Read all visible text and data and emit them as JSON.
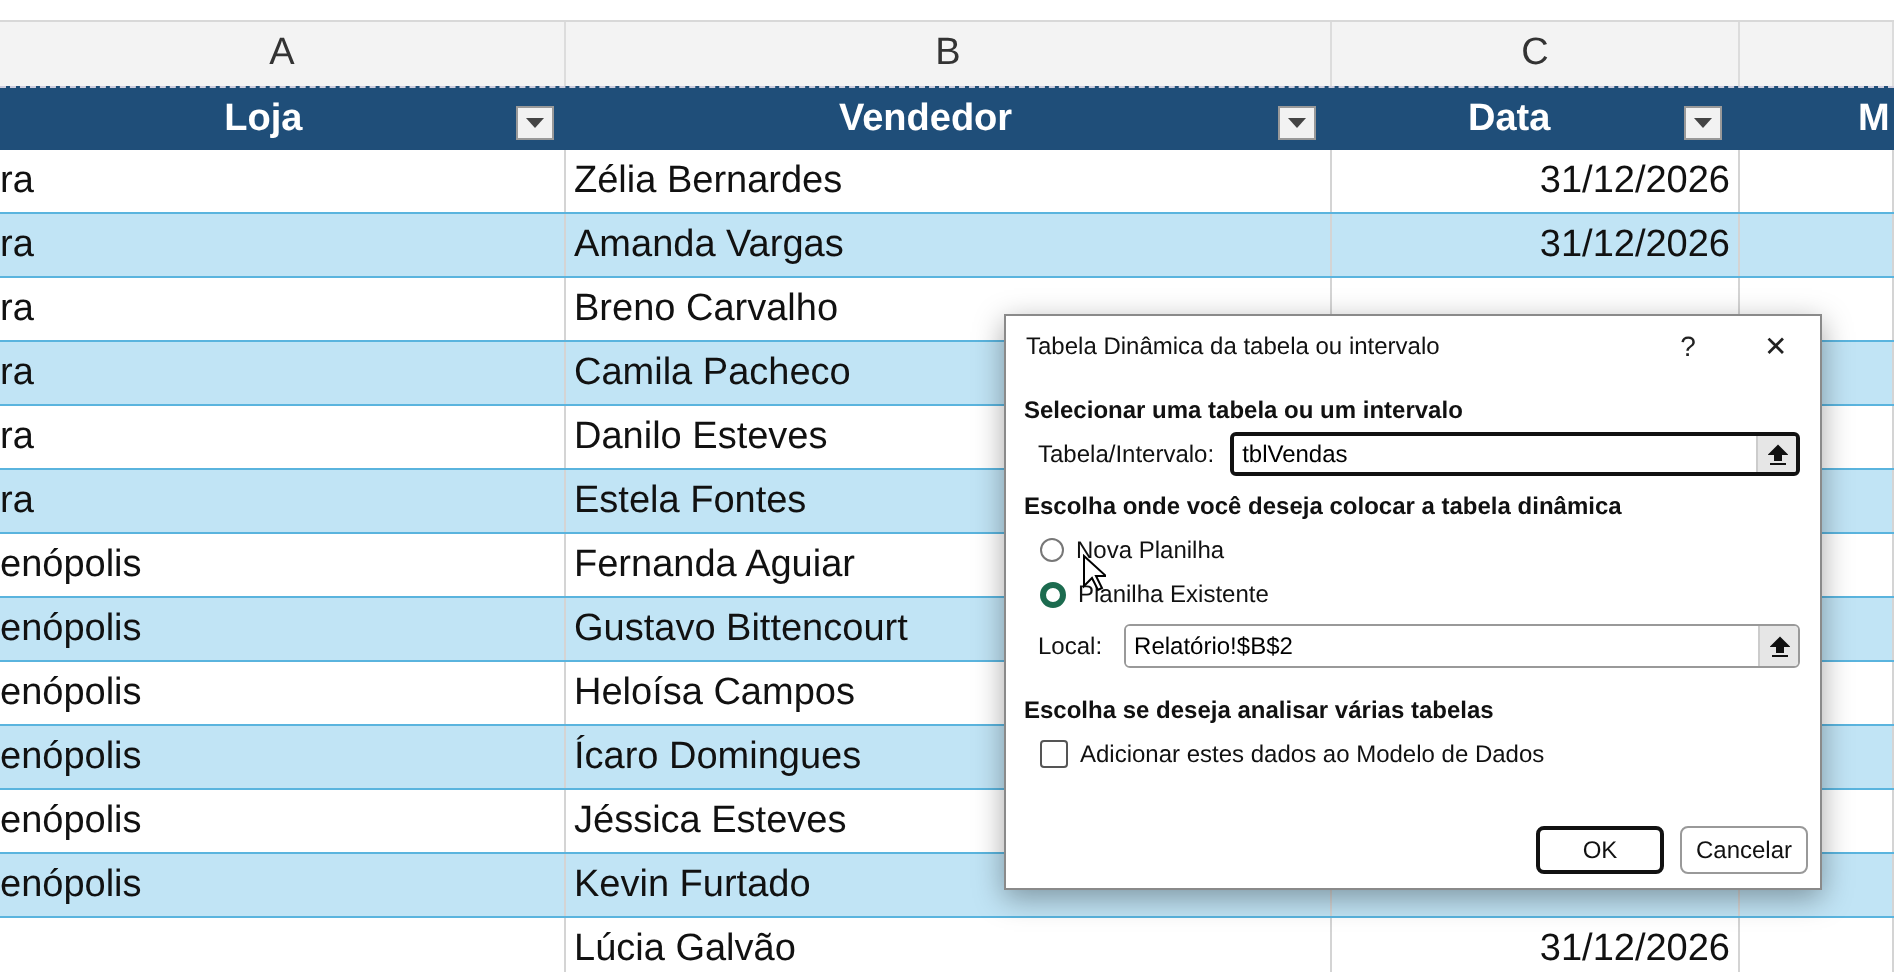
{
  "column_letters": [
    "A",
    "B",
    "C"
  ],
  "table": {
    "columns": [
      {
        "label": "Loja",
        "filter": true
      },
      {
        "label": "Vendedor",
        "filter": true
      },
      {
        "label": "Data",
        "filter": true
      },
      {
        "label": "M",
        "filter": false
      }
    ],
    "rows": [
      {
        "cells": [
          "ra",
          "Zélia Bernardes",
          "31/12/2026",
          ""
        ]
      },
      {
        "cells": [
          "ra",
          "Amanda Vargas",
          "31/12/2026",
          ""
        ]
      },
      {
        "cells": [
          "ra",
          "Breno Carvalho",
          "",
          ""
        ]
      },
      {
        "cells": [
          "ra",
          "Camila Pacheco",
          "",
          ""
        ]
      },
      {
        "cells": [
          "ra",
          "Danilo Esteves",
          "",
          ""
        ]
      },
      {
        "cells": [
          "ra",
          "Estela Fontes",
          "",
          ""
        ]
      },
      {
        "cells": [
          "enópolis",
          "Fernanda Aguiar",
          "",
          ""
        ]
      },
      {
        "cells": [
          "enópolis",
          "Gustavo Bittencourt",
          "",
          ""
        ]
      },
      {
        "cells": [
          "enópolis",
          "Heloísa Campos",
          "",
          ""
        ]
      },
      {
        "cells": [
          "enópolis",
          "Ícaro Domingues",
          "",
          ""
        ]
      },
      {
        "cells": [
          "enópolis",
          "Jéssica Esteves",
          "",
          ""
        ]
      },
      {
        "cells": [
          "enópolis",
          "Kevin Furtado",
          "",
          ""
        ]
      },
      {
        "cells": [
          "",
          "Lúcia Galvão",
          "31/12/2026",
          ""
        ]
      }
    ]
  },
  "dialog": {
    "title": "Tabela Dinâmica da tabela ou intervalo",
    "help": "?",
    "close": "✕",
    "section_1": "Selecionar uma tabela ou um intervalo",
    "range_label": "Tabela/Intervalo:",
    "range_value": "tblVendas",
    "section_2": "Escolha onde você deseja colocar a tabela dinâmica",
    "options": [
      {
        "label": "Nova Planilha",
        "selected": false
      },
      {
        "label": "Planilha Existente",
        "selected": true
      }
    ],
    "local_label": "Local:",
    "local_value": "Relatório!$B$2",
    "section_3": "Escolha se deseja analisar várias tabelas",
    "data_model": {
      "label": "Adicionar estes dados ao Modelo de Dados",
      "checked": false
    },
    "buttons": [
      {
        "label": "OK",
        "default": true
      },
      {
        "label": "Cancelar",
        "default": false
      }
    ]
  }
}
